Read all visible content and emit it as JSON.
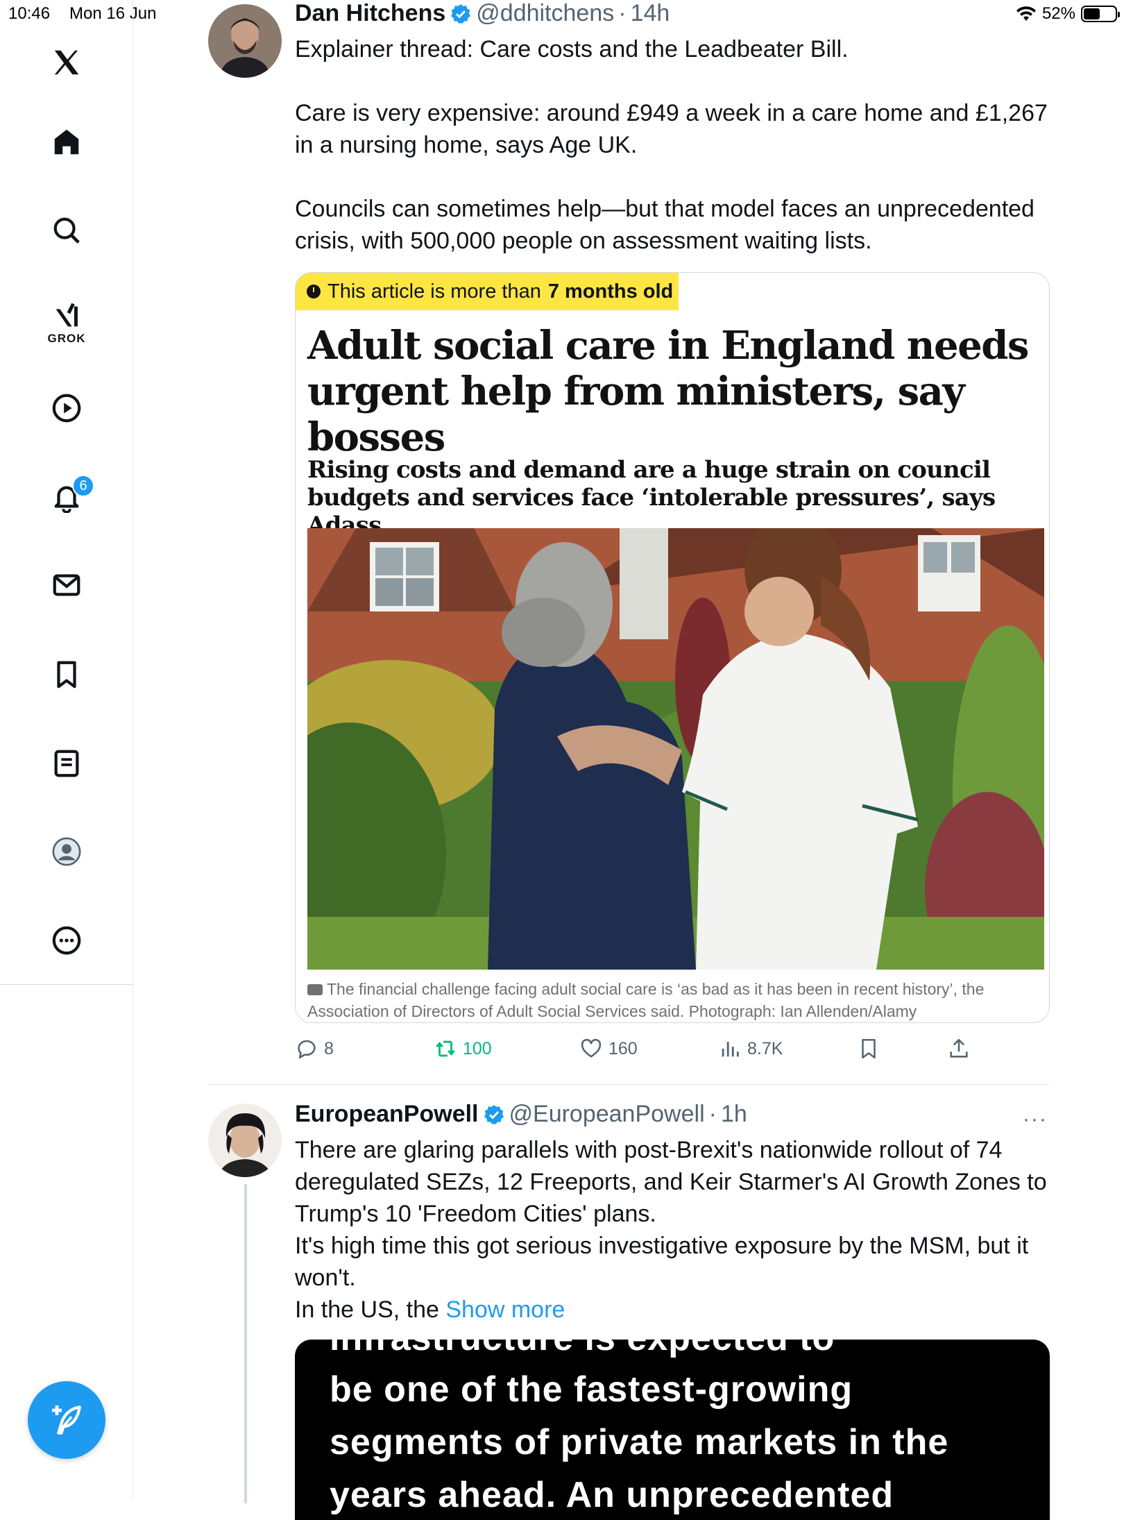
{
  "status_bar": {
    "time": "10:46",
    "date": "Mon 16 Jun",
    "battery": "52%",
    "battery_level": 0.52
  },
  "nav": {
    "grok_label": "GROK",
    "notifications_count": "6",
    "icons": [
      "x-logo-icon",
      "home-icon",
      "search-icon",
      "grok-icon",
      "video-icon",
      "notifications-bell-icon",
      "messages-icon",
      "bookmarks-icon",
      "lists-icon",
      "profile-icon",
      "more-circle-icon",
      "compose-icon"
    ]
  },
  "post1": {
    "author": "Dan Hitchens",
    "handle": "@ddhitchens",
    "separator": "·",
    "time": "14h",
    "text": "Explainer thread: Care costs and the Leadbeater Bill.\n\nCare is very expensive: around £949 a week in a care home and £1,267 in a nursing home, says Age UK.\n\nCouncils can sometimes help—but that model faces an unprecedented crisis, with 500,000 people on assessment waiting lists.",
    "card": {
      "banner_prefix": "This article is more than",
      "banner_age": "7 months old",
      "headline": "Adult social care in England needs urgent help from ministers, say bosses",
      "standfirst": "Rising costs and demand are a huge strain on council budgets and services face ‘intolerable pressures’, says Adass",
      "caption": "The financial challenge facing adult social care is ‘as bad as it has been in recent history’, the Association of Directors of Adult Social Services said. Photograph: Ian Allenden/Alamy"
    },
    "actions": {
      "replies": "8",
      "reposts": "100",
      "likes": "160",
      "views": "8.7K"
    }
  },
  "post2": {
    "author": "EuropeanPowell",
    "handle": "@EuropeanPowell",
    "separator": "·",
    "time": "1h",
    "more": "···",
    "text": "There are glaring parallels with post-Brexit's nationwide rollout of 74 deregulated SEZs, 12 Freeports, and Keir Starmer's AI Growth Zones to Trump's 10 'Freedom Cities' plans.\nIt's high time this got serious investigative exposure by the MSM, but it won't.\nIn the US, the ",
    "show_more": "Show more",
    "video_lines": [
      "infrastructure is expected to",
      "be one of the fastest-growing",
      "segments of private markets in the",
      "years ahead. An unprecedented"
    ]
  },
  "colors": {
    "accent": "#1d9bf0",
    "retweet": "#00ba7c",
    "banner": "#fde542",
    "secondary_text": "#536471"
  }
}
